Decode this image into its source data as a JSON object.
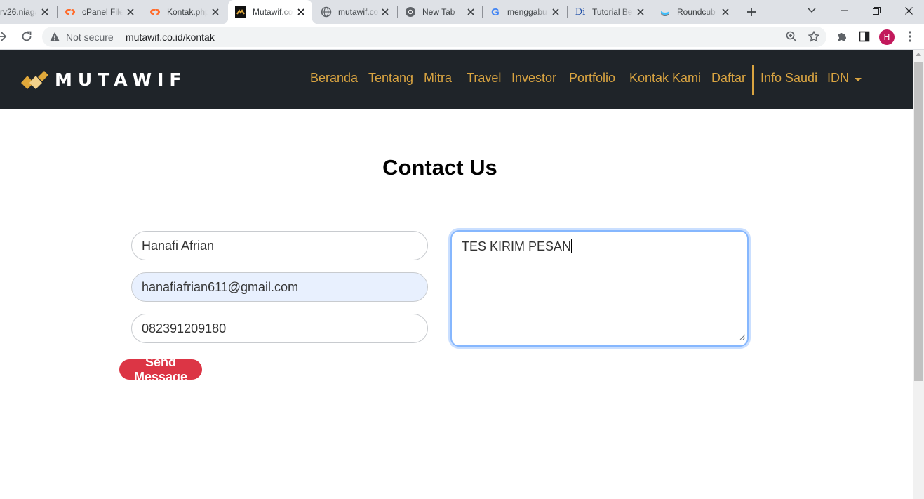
{
  "tabs": [
    {
      "title": "rv26.niaga",
      "favicon": "server-icon"
    },
    {
      "title": "cPanel File",
      "favicon": "cpanel-icon"
    },
    {
      "title": "Kontak.php",
      "favicon": "cpanel-icon"
    },
    {
      "title": "Mutawif.co",
      "favicon": "mutawif-icon",
      "active": true
    },
    {
      "title": "mutawif.co",
      "favicon": "globe-icon"
    },
    {
      "title": "New Tab",
      "favicon": "chrome-icon"
    },
    {
      "title": "menggabu",
      "favicon": "google-icon"
    },
    {
      "title": "Tutorial Be",
      "favicon": "dewaweb-icon"
    },
    {
      "title": "Roundcub",
      "favicon": "roundcube-icon"
    }
  ],
  "browser": {
    "security_label": "Not secure",
    "url": "mutawif.co.id/kontak",
    "profile_initial": "H"
  },
  "site": {
    "brand": "MUTAWIF",
    "nav": [
      "Beranda",
      "Tentang",
      "Mitra",
      "Travel",
      "Investor",
      "Portfolio",
      "Kontak Kami",
      "Daftar",
      "Info Saudi",
      "IDN"
    ],
    "colors": {
      "navbar_bg": "#1f2429",
      "nav_text": "#d9a441",
      "send_button": "#dc3545",
      "focus_ring": "#86b7fe"
    }
  },
  "contact": {
    "title": "Contact Us",
    "name_value": "Hanafi Afrian",
    "email_value": "hanafiafrian611@gmail.com",
    "phone_value": "082391209180",
    "message_value": "TES KIRIM PESAN",
    "send_label": "Send Message"
  }
}
